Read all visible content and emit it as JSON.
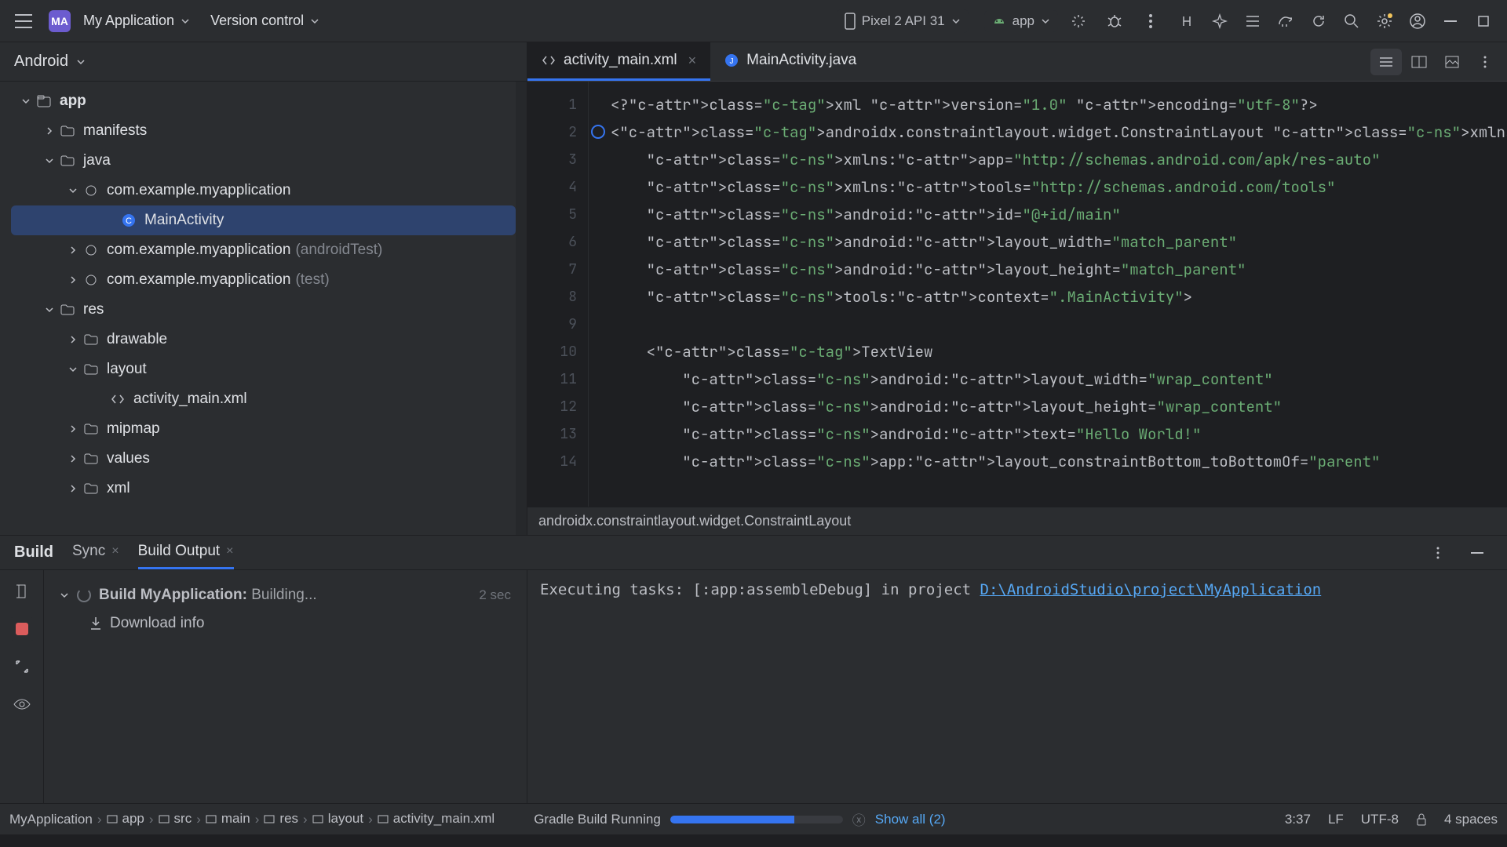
{
  "topbar": {
    "app_badge": "MA",
    "app_name": "My Application",
    "vcs_label": "Version control",
    "device_name": "Pixel 2 API 31",
    "config_name": "app"
  },
  "sidebar": {
    "header": "Android",
    "tree": {
      "app": "app",
      "manifests": "manifests",
      "java": "java",
      "pkg1": "com.example.myapplication",
      "mainActivity": "MainActivity",
      "pkg2": "com.example.myapplication",
      "pkg2_suffix": "(androidTest)",
      "pkg3": "com.example.myapplication",
      "pkg3_suffix": "(test)",
      "res": "res",
      "drawable": "drawable",
      "layout": "layout",
      "activity_xml": "activity_main.xml",
      "mipmap": "mipmap",
      "values": "values",
      "xml": "xml"
    }
  },
  "tabs": {
    "tab1": "activity_main.xml",
    "tab2": "MainActivity.java"
  },
  "breadcrumb_editor": "androidx.constraintlayout.widget.ConstraintLayout",
  "code_lines": [
    "<?xml version=\"1.0\" encoding=\"utf-8\"?>",
    "<androidx.constraintlayout.widget.ConstraintLayout xmlns:android=\"http://schemas.androi",
    "    xmlns:app=\"http://schemas.android.com/apk/res-auto\"",
    "    xmlns:tools=\"http://schemas.android.com/tools\"",
    "    android:id=\"@+id/main\"",
    "    android:layout_width=\"match_parent\"",
    "    android:layout_height=\"match_parent\"",
    "    tools:context=\".MainActivity\">",
    "",
    "    <TextView",
    "        android:layout_width=\"wrap_content\"",
    "        android:layout_height=\"wrap_content\"",
    "        android:text=\"Hello World!\"",
    "        app:layout_constraintBottom_toBottomOf=\"parent\""
  ],
  "build": {
    "panel_title": "Build",
    "tab_sync": "Sync",
    "tab_output": "Build Output",
    "task_label": "Build MyApplication:",
    "task_status": "Building...",
    "task_time": "2 sec",
    "download": "Download info",
    "console_prefix": "Executing tasks: [:app:assembleDebug] in project ",
    "console_path": "D:\\AndroidStudio\\project\\MyApplication"
  },
  "statusbar": {
    "crumbs": [
      "MyApplication",
      "app",
      "src",
      "main",
      "res",
      "layout",
      "activity_main.xml"
    ],
    "gradle": "Gradle Build Running",
    "show_all": "Show all (2)",
    "pos": "3:37",
    "line_ending": "LF",
    "encoding": "UTF-8",
    "indent": "4 spaces"
  }
}
